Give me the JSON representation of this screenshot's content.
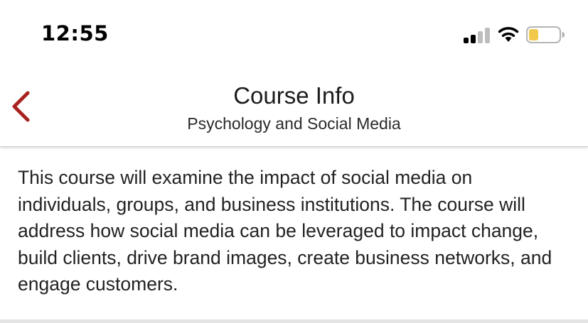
{
  "status_bar": {
    "time": "12:55",
    "signal_icon": "cellular-signal-icon",
    "wifi_icon": "wifi-icon",
    "battery_icon": "battery-low-icon",
    "battery_color": "#f2c94c"
  },
  "nav": {
    "back_icon": "chevron-left-icon",
    "accent_color": "#a8231f",
    "title": "Course Info",
    "subtitle": "Psychology and Social Media"
  },
  "course": {
    "description": "This course will examine the impact of social media on individuals, groups, and business institutions. The course will address how social media can be leveraged to impact change, build clients, drive brand images, create business networks, and engage customers."
  }
}
